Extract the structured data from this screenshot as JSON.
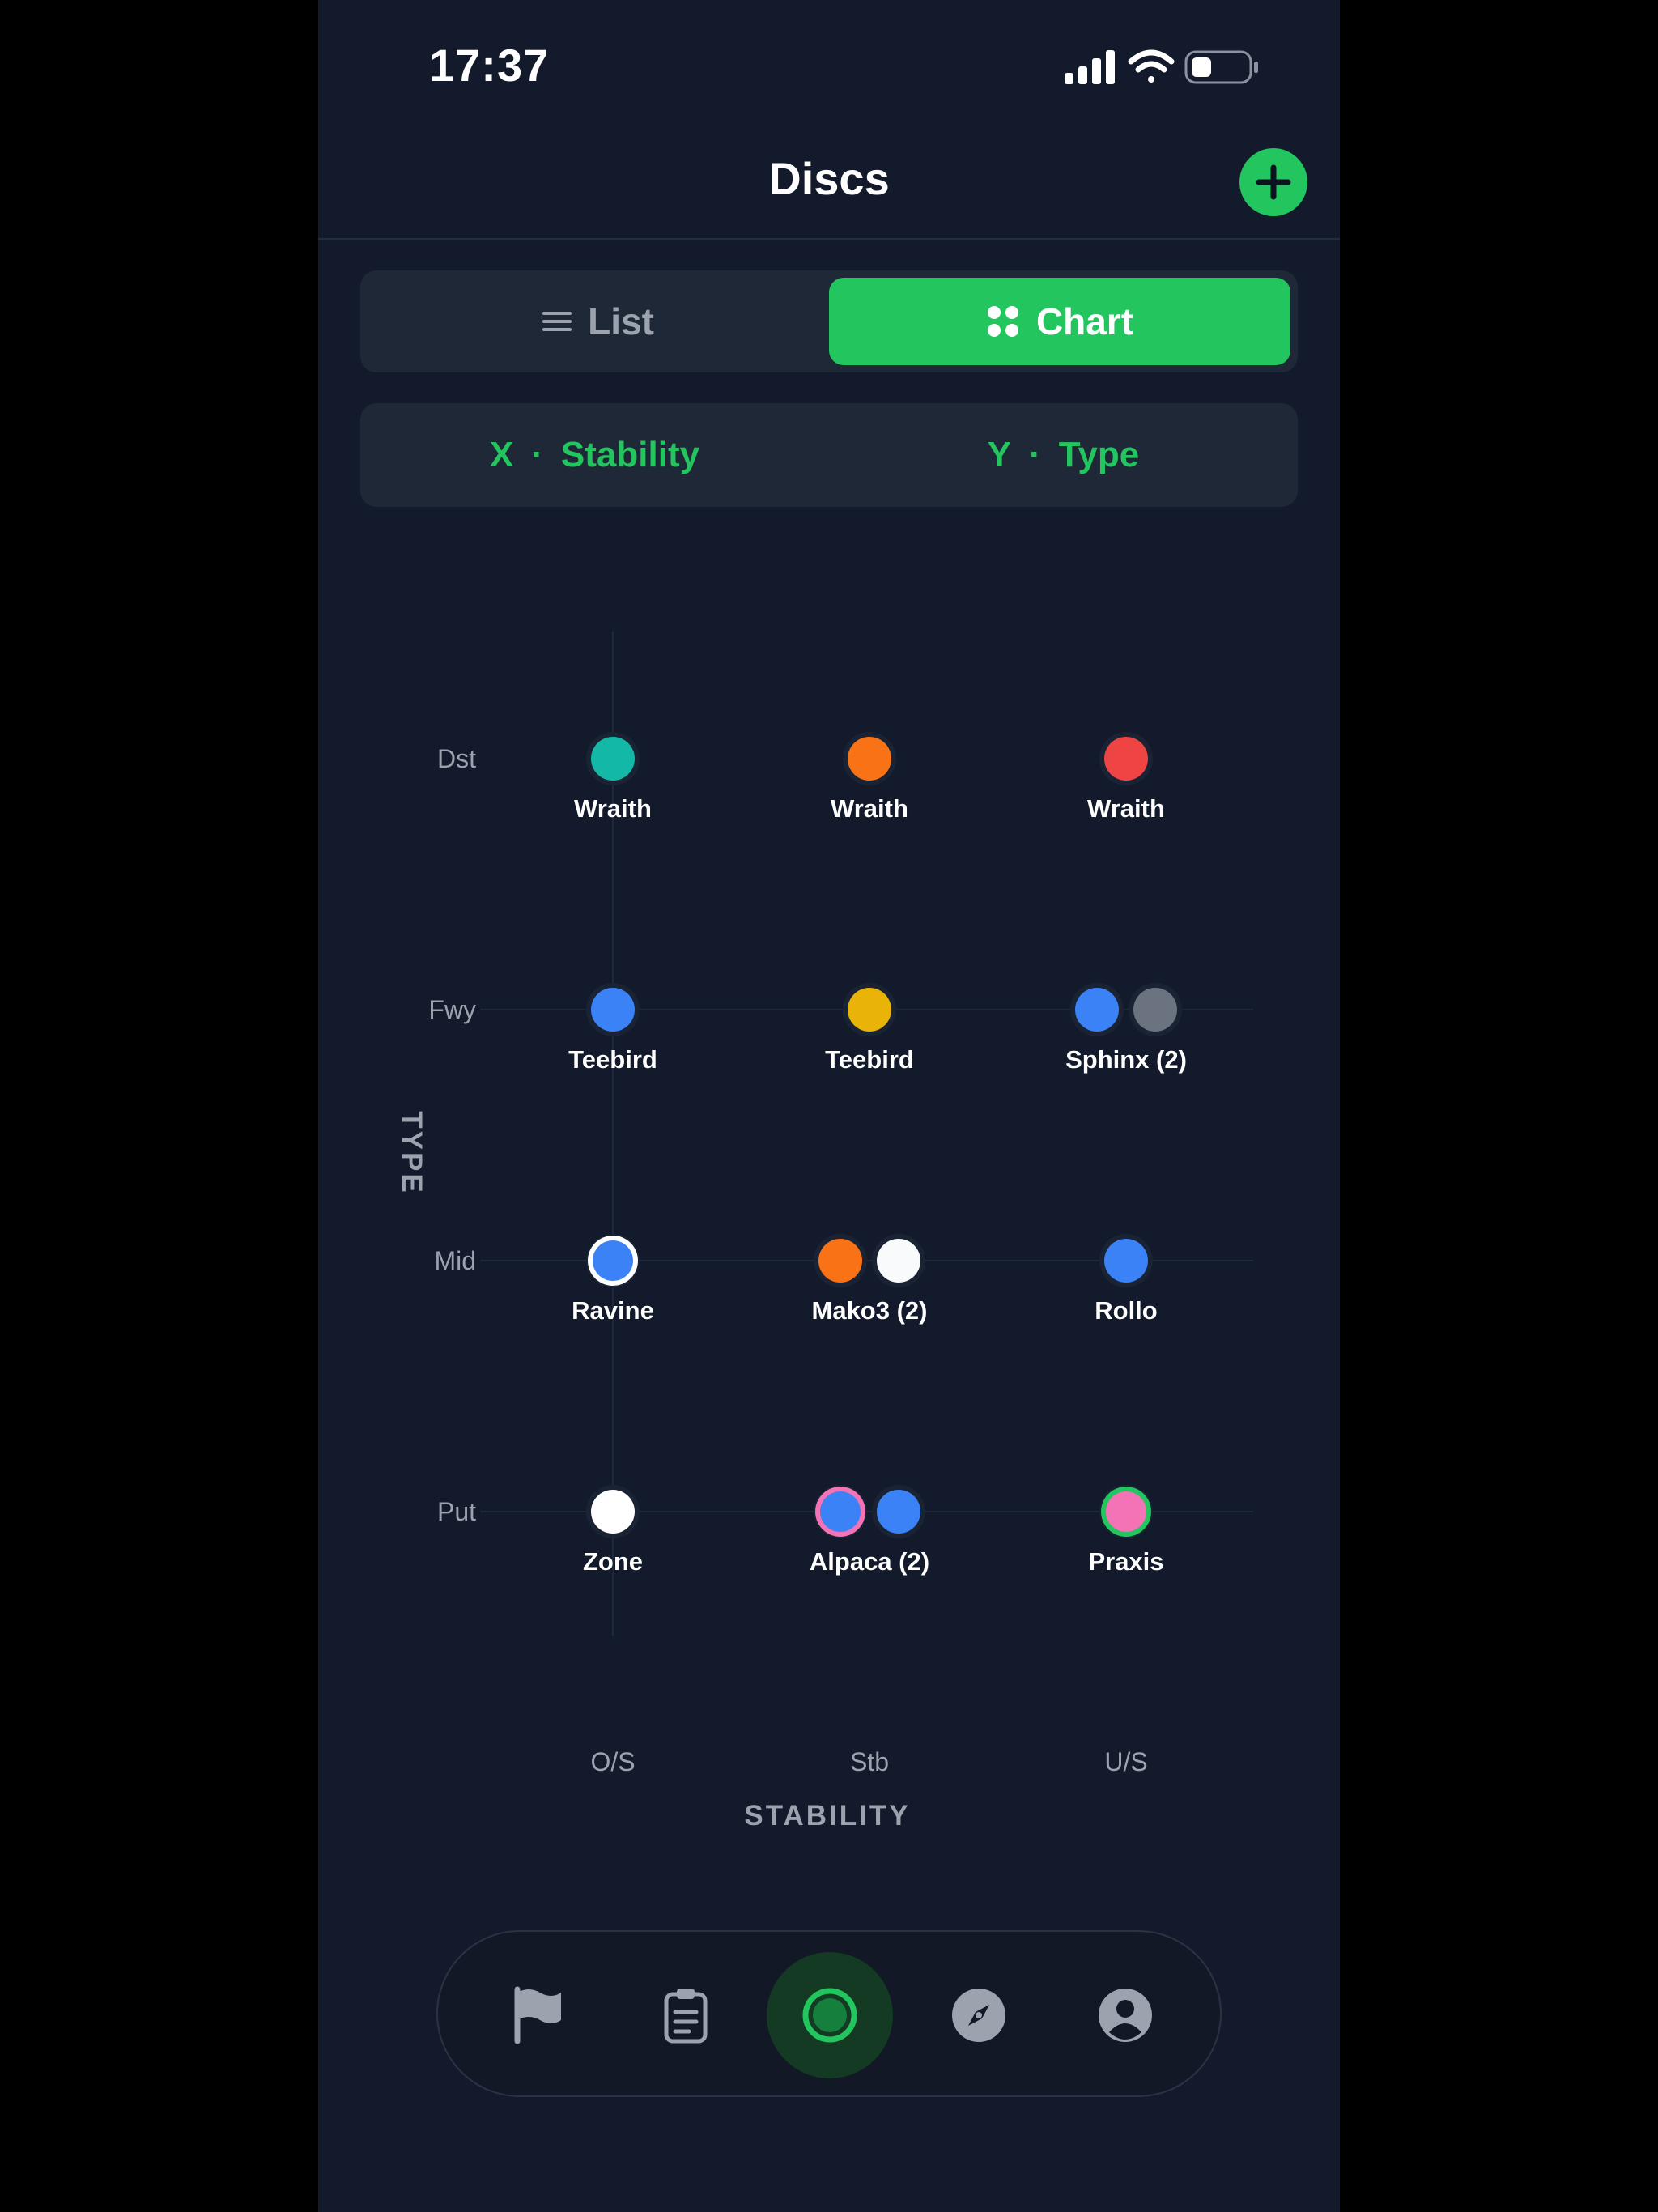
{
  "status_bar": {
    "time": "17:37"
  },
  "header": {
    "title": "Discs"
  },
  "view_toggle": {
    "list_label": "List",
    "chart_label": "Chart",
    "active": "Chart"
  },
  "axes": {
    "x_label": "X",
    "x_value": "Stability",
    "y_label": "Y",
    "y_value": "Type",
    "separator": "·"
  },
  "chart_data": {
    "type": "scatter",
    "x_categories": [
      "O/S",
      "Stb",
      "U/S"
    ],
    "y_categories": [
      "Dst",
      "Fwy",
      "Mid",
      "Put"
    ],
    "xlabel": "STABILITY",
    "ylabel": "TYPE",
    "groups": [
      {
        "x": "O/S",
        "y": "Dst",
        "label": "Wraith",
        "discs": [
          {
            "color": "#14b8a6"
          }
        ]
      },
      {
        "x": "Stb",
        "y": "Dst",
        "label": "Wraith",
        "discs": [
          {
            "color": "#f97316"
          }
        ]
      },
      {
        "x": "U/S",
        "y": "Dst",
        "label": "Wraith",
        "discs": [
          {
            "color": "#ef4444"
          }
        ]
      },
      {
        "x": "O/S",
        "y": "Fwy",
        "label": "Teebird",
        "discs": [
          {
            "color": "#3b82f6"
          }
        ]
      },
      {
        "x": "Stb",
        "y": "Fwy",
        "label": "Teebird",
        "discs": [
          {
            "color": "#eab308"
          }
        ]
      },
      {
        "x": "U/S",
        "y": "Fwy",
        "label": "Sphinx (2)",
        "discs": [
          {
            "color": "#3b82f6"
          },
          {
            "color": "#6b7280"
          }
        ]
      },
      {
        "x": "O/S",
        "y": "Mid",
        "label": "Ravine",
        "discs": [
          {
            "color": "#3b82f6",
            "ring": "#ffffff"
          }
        ]
      },
      {
        "x": "Stb",
        "y": "Mid",
        "label": "Mako3 (2)",
        "discs": [
          {
            "color": "#f97316"
          },
          {
            "color": "#f8fafc"
          }
        ]
      },
      {
        "x": "U/S",
        "y": "Mid",
        "label": "Rollo",
        "discs": [
          {
            "color": "#3b82f6"
          }
        ]
      },
      {
        "x": "O/S",
        "y": "Put",
        "label": "Zone",
        "discs": [
          {
            "color": "#ffffff"
          }
        ]
      },
      {
        "x": "Stb",
        "y": "Put",
        "label": "Alpaca (2)",
        "discs": [
          {
            "color": "#3b82f6",
            "ring": "#f472b6"
          },
          {
            "color": "#3b82f6"
          }
        ]
      },
      {
        "x": "U/S",
        "y": "Put",
        "label": "Praxis",
        "discs": [
          {
            "color": "#f472b6",
            "ring": "#22c55e"
          }
        ]
      }
    ]
  },
  "nav": {
    "items": [
      {
        "icon": "flag-icon",
        "active": false
      },
      {
        "icon": "clipboard-icon",
        "active": false
      },
      {
        "icon": "disc-icon",
        "active": true
      },
      {
        "icon": "compass-icon",
        "active": false
      },
      {
        "icon": "profile-icon",
        "active": false
      }
    ]
  },
  "colors": {
    "accent": "#22c55e",
    "background": "#121a2b",
    "surface": "#1f2837"
  }
}
